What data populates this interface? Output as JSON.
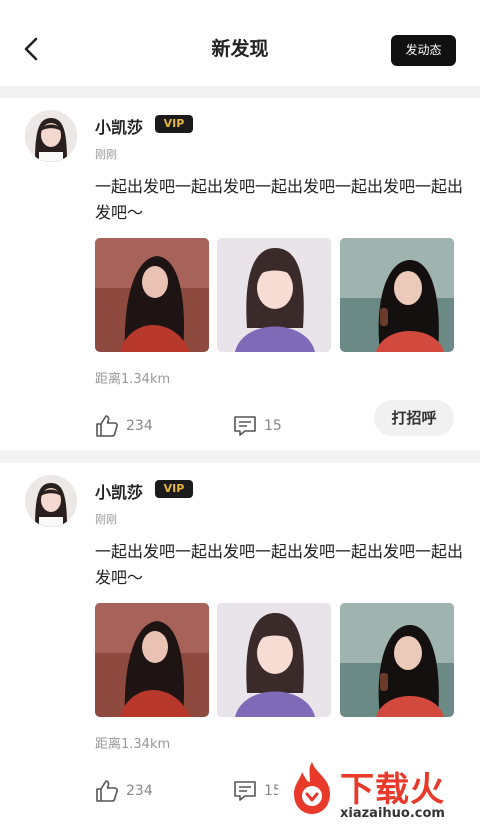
{
  "header": {
    "title": "新发现",
    "post_button": "发动态"
  },
  "posts": [
    {
      "username": "小凯莎",
      "badge": "VIP",
      "time": "刚刚",
      "text": "一起出发吧一起出发吧一起出发吧一起出发吧一起出发吧～",
      "distance": "距离1.34km",
      "likes": "234",
      "comments": "15",
      "greet_button": "打招呼"
    },
    {
      "username": "小凯莎",
      "badge": "VIP",
      "time": "刚刚",
      "text": "一起出发吧一起出发吧一起出发吧一起出发吧一起出发吧～",
      "distance": "距离1.34km",
      "likes": "234",
      "comments": "15"
    }
  ],
  "watermark": {
    "brand": "下载火",
    "url": "xiazaihuo.com"
  },
  "colors": {
    "vip_text": "#e7b43c",
    "vip_bg": "#1b1b1b",
    "watermark": "#e8392a"
  }
}
